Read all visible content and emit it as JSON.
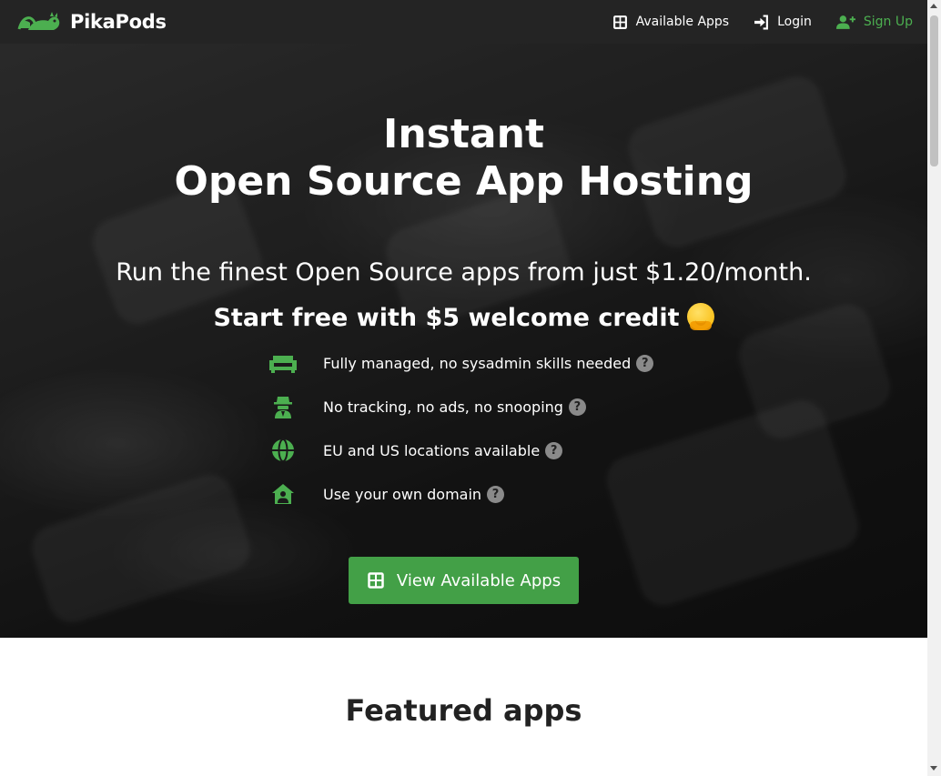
{
  "navbar": {
    "brand": "PikaPods",
    "items": [
      {
        "label": "Available Apps",
        "icon": "grid-icon"
      },
      {
        "label": "Login",
        "icon": "login-icon"
      },
      {
        "label": "Sign Up",
        "icon": "user-plus-icon"
      }
    ]
  },
  "hero": {
    "title_line1": "Instant",
    "title_line2": "Open Source App Hosting",
    "subtitle": "Run the finest Open Source apps from just $1.20/month.",
    "credit": "Start free with $5 welcome credit",
    "features": [
      {
        "text": "Fully managed, no sysadmin skills needed",
        "icon": "sofa-icon"
      },
      {
        "text": "No tracking, no ads, no snooping",
        "icon": "spy-icon"
      },
      {
        "text": "EU and US locations available",
        "icon": "globe-icon"
      },
      {
        "text": "Use your own domain",
        "icon": "home-user-icon"
      }
    ],
    "help_glyph": "?",
    "cta_label": "View Available Apps"
  },
  "featured": {
    "title": "Featured apps"
  },
  "colors": {
    "accent": "#43a047",
    "navbar_bg": "#242424"
  }
}
